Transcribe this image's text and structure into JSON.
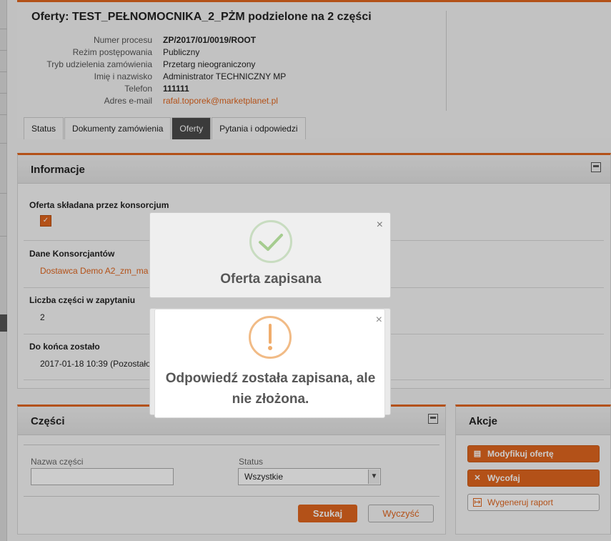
{
  "header": {
    "title": "Oferty: TEST_PEŁNOMOCNIKA_2_PŻM podzielone na 2 części",
    "details": [
      {
        "label": "Numer procesu",
        "value": "ZP/2017/01/0019/ROOT"
      },
      {
        "label": "Reżim postępowania",
        "value": "Publiczny"
      },
      {
        "label": "Tryb udzielenia zamówienia",
        "value": "Przetarg nieograniczony"
      },
      {
        "label": "Imię i nazwisko",
        "value": "Administrator TECHNICZNY MP"
      },
      {
        "label": "Telefon",
        "value": "111111"
      },
      {
        "label": "Adres e-mail",
        "value": "rafal.toporek@marketplanet.pl"
      }
    ],
    "tabs": [
      {
        "label": "Status"
      },
      {
        "label": "Dokumenty zamówienia"
      },
      {
        "label": "Oferty"
      },
      {
        "label": "Pytania i odpowiedzi"
      }
    ],
    "active_tab": "Oferty"
  },
  "info": {
    "title": "Informacje",
    "consortium_label": "Oferta składana przez konsorcjum",
    "consortium_checked": true,
    "check_mark": "✓",
    "consortium_members_label": "Dane Konsorcjantów",
    "consortium_members_value": "Dostawca Demo A2_zm_ma",
    "parts_count_label": "Liczba części w zapytaniu",
    "parts_count_value": "2",
    "deadline_label": "Do końca zostało",
    "deadline_value": "2017-01-18 10:39 (Pozostało"
  },
  "parts": {
    "title": "Części",
    "name_label": "Nazwa części",
    "name_value": "",
    "status_label": "Status",
    "status_value": "Wszystkie",
    "search_button": "Szukaj",
    "clear_button": "Wyczyść"
  },
  "actions": {
    "title": "Akcje",
    "modify": "Modyfikuj ofertę",
    "withdraw": "Wycofaj",
    "report": "Wygeneruj raport"
  },
  "modals": {
    "saved_title": "Oferta zapisana",
    "warning_line1": "Odpowiedź została zapisana, ale",
    "warning_line2": "nie złożona.",
    "close_symbol": "×",
    "warning_mark": "!"
  },
  "colors": {
    "accent": "#e0661f",
    "success": "#a5cc8f",
    "warning": "#f0ad6c"
  }
}
